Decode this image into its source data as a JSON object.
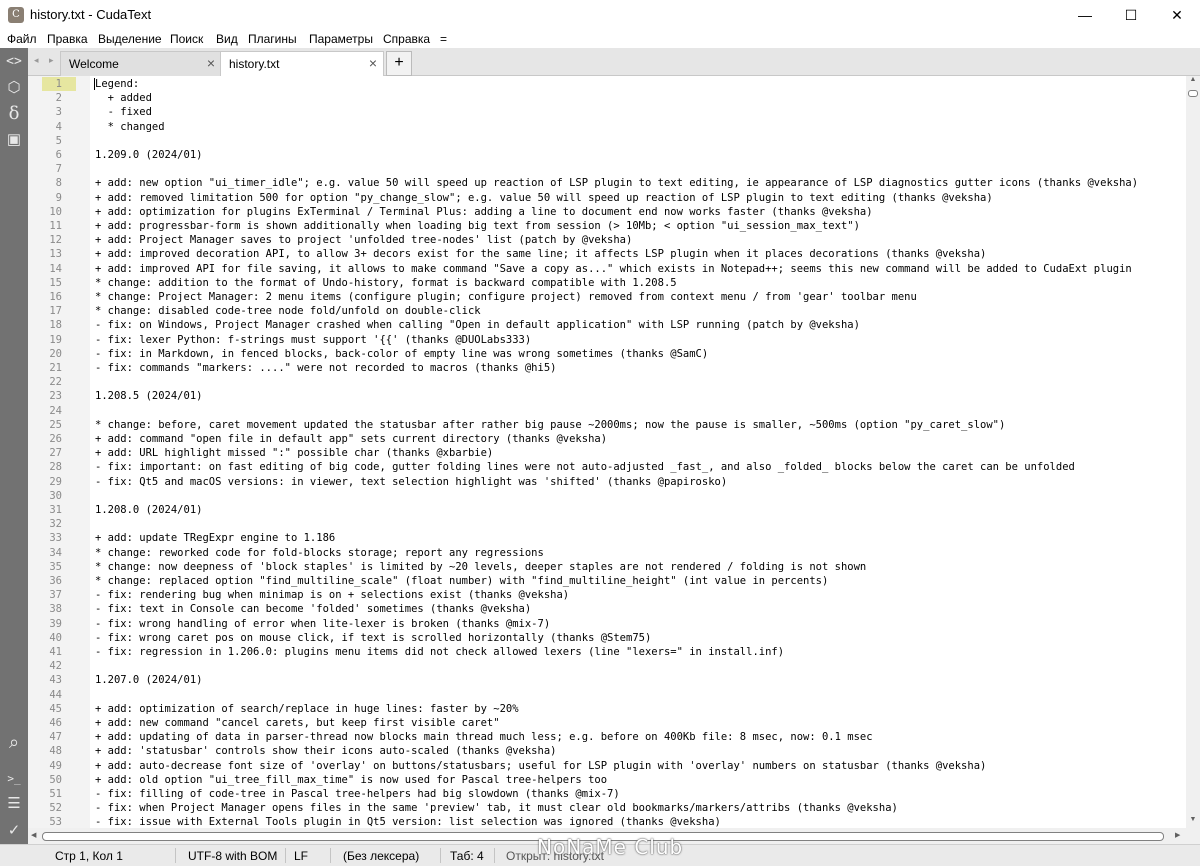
{
  "window": {
    "title": "history.txt - CudaText",
    "app_icon_glyph": "C",
    "minimize_glyph": "—",
    "maximize_glyph": "☐",
    "close_glyph": "✕"
  },
  "menu": [
    "Файл",
    "Правка",
    "Выделение",
    "Поиск",
    "Вид",
    "Плагины",
    "Параметры",
    "Справка",
    "="
  ],
  "sidebar": {
    "top": [
      {
        "icon": "code-brackets-icon",
        "glyph": "<>"
      },
      {
        "icon": "box-icon",
        "glyph": "⬡"
      },
      {
        "icon": "delta-icon",
        "glyph": "δ"
      },
      {
        "icon": "window-icon",
        "glyph": "▣"
      }
    ],
    "bottom": [
      {
        "icon": "search-icon",
        "glyph": "⌕"
      },
      {
        "icon": "console-icon",
        "glyph": ">_"
      },
      {
        "icon": "list-icon",
        "glyph": "☰"
      },
      {
        "icon": "check-icon",
        "glyph": "✓"
      }
    ]
  },
  "tabs": [
    {
      "label": "Welcome",
      "active": false,
      "close": "×"
    },
    {
      "label": "history.txt",
      "active": true,
      "close": "×"
    }
  ],
  "tab_add_label": "+",
  "tab_arrows": "◂ ▸",
  "editor": {
    "current_line": 1,
    "lines": [
      "Legend:",
      "  + added",
      "  - fixed",
      "  * changed",
      "",
      "1.209.0 (2024/01)",
      "",
      "+ add: new option \"ui_timer_idle\"; e.g. value 50 will speed up reaction of LSP plugin to text editing, ie appearance of LSP diagnostics gutter icons (thanks @veksha)",
      "+ add: removed limitation 500 for option \"py_change_slow\"; e.g. value 50 will speed up reaction of LSP plugin to text editing (thanks @veksha)",
      "+ add: optimization for plugins ExTerminal / Terminal Plus: adding a line to document end now works faster (thanks @veksha)",
      "+ add: progressbar-form is shown additionally when loading big text from session (> 10Mb; < option \"ui_session_max_text\")",
      "+ add: Project Manager saves to project 'unfolded tree-nodes' list (patch by @veksha)",
      "+ add: improved decoration API, to allow 3+ decors exist for the same line; it affects LSP plugin when it places decorations (thanks @veksha)",
      "+ add: improved API for file saving, it allows to make command \"Save a copy as...\" which exists in Notepad++; seems this new command will be added to CudaExt plugin",
      "* change: addition to the format of Undo-history, format is backward compatible with 1.208.5",
      "* change: Project Manager: 2 menu items (configure plugin; configure project) removed from context menu / from 'gear' toolbar menu",
      "* change: disabled code-tree node fold/unfold on double-click",
      "- fix: on Windows, Project Manager crashed when calling \"Open in default application\" with LSP running (patch by @veksha)",
      "- fix: lexer Python: f-strings must support '{{' (thanks @DUOLabs333)",
      "- fix: in Markdown, in fenced blocks, back-color of empty line was wrong sometimes (thanks @SamC)",
      "- fix: commands \"markers: ....\" were not recorded to macros (thanks @hi5)",
      "",
      "1.208.5 (2024/01)",
      "",
      "* change: before, caret movement updated the statusbar after rather big pause ~2000ms; now the pause is smaller, ~500ms (option \"py_caret_slow\")",
      "+ add: command \"open file in default app\" sets current directory (thanks @veksha)",
      "+ add: URL highlight missed \":\" possible char (thanks @xbarbie)",
      "- fix: important: on fast editing of big code, gutter folding lines were not auto-adjusted _fast_, and also _folded_ blocks below the caret can be unfolded",
      "- fix: Qt5 and macOS versions: in viewer, text selection highlight was 'shifted' (thanks @papirosko)",
      "",
      "1.208.0 (2024/01)",
      "",
      "+ add: update TRegExpr engine to 1.186",
      "* change: reworked code for fold-blocks storage; report any regressions",
      "* change: now deepness of 'block staples' is limited by ~20 levels, deeper staples are not rendered / folding is not shown",
      "* change: replaced option \"find_multiline_scale\" (float number) with \"find_multiline_height\" (int value in percents)",
      "- fix: rendering bug when minimap is on + selections exist (thanks @veksha)",
      "- fix: text in Console can become 'folded' sometimes (thanks @veksha)",
      "- fix: wrong handling of error when lite-lexer is broken (thanks @mix-7)",
      "- fix: wrong caret pos on mouse click, if text is scrolled horizontally (thanks @Stem75)",
      "- fix: regression in 1.206.0: plugins menu items did not check allowed lexers (line \"lexers=\" in install.inf)",
      "",
      "1.207.0 (2024/01)",
      "",
      "+ add: optimization of search/replace in huge lines: faster by ~20%",
      "+ add: new command \"cancel carets, but keep first visible caret\"",
      "+ add: updating of data in parser-thread now blocks main thread much less; e.g. before on 400Kb file: 8 msec, now: 0.1 msec",
      "+ add: 'statusbar' controls show their icons auto-scaled (thanks @veksha)",
      "+ add: auto-decrease font size of 'overlay' on buttons/statusbars; useful for LSP plugin with 'overlay' numbers on statusbar (thanks @veksha)",
      "+ add: old option \"ui_tree_fill_max_time\" is now used for Pascal tree-helpers too",
      "- fix: filling of code-tree in Pascal tree-helpers had big slowdown (thanks @mix-7)",
      "- fix: when Project Manager opens files in the same 'preview' tab, it must clear old bookmarks/markers/attribs (thanks @veksha)",
      "- fix: issue with External Tools plugin in Qt5 version: list selection was ignored (thanks @veksha)"
    ]
  },
  "statusbar": {
    "position": "Стр 1, Кол 1",
    "encoding": "UTF-8 with BOM",
    "line_ending": "LF",
    "lexer": "(Без лексера)",
    "tab": "Таб: 4",
    "message": "Открыт: history.txt"
  },
  "watermark": "NoNaMe Club"
}
